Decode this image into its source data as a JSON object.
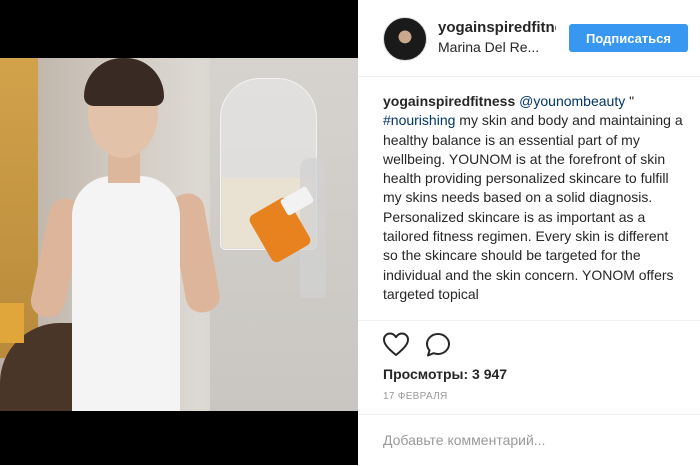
{
  "header": {
    "username": "yogainspiredfitness",
    "location": "Marina Del Re...",
    "follow_label": "Подписаться"
  },
  "caption": {
    "author": "yogainspiredfitness",
    "mention": "@younombeauty",
    "quote_open": " \"",
    "hashtag": "#nourishing",
    "text": " my skin and body and maintaining a healthy balance is an essential part of my wellbeing. YOUNOM is at the forefront of skin health providing personalized skincare to fulfill my skins needs based on a solid diagnosis. Personalized skincare is as important as a tailored fitness regimen. Every skin is different so the skincare should be targeted for the individual and the skin concern. YONOM offers targeted topical"
  },
  "actions": {
    "like_icon": "heart-icon",
    "comment_icon": "comment-bubble-icon"
  },
  "stats": {
    "views": "Просмотры: 3 947",
    "date": "17 ФЕВРАЛЯ"
  },
  "comment": {
    "placeholder": "Добавьте комментарий..."
  },
  "colors": {
    "accent": "#3897f0",
    "link": "#003569",
    "muted": "#999999",
    "media_background": "#000000"
  }
}
